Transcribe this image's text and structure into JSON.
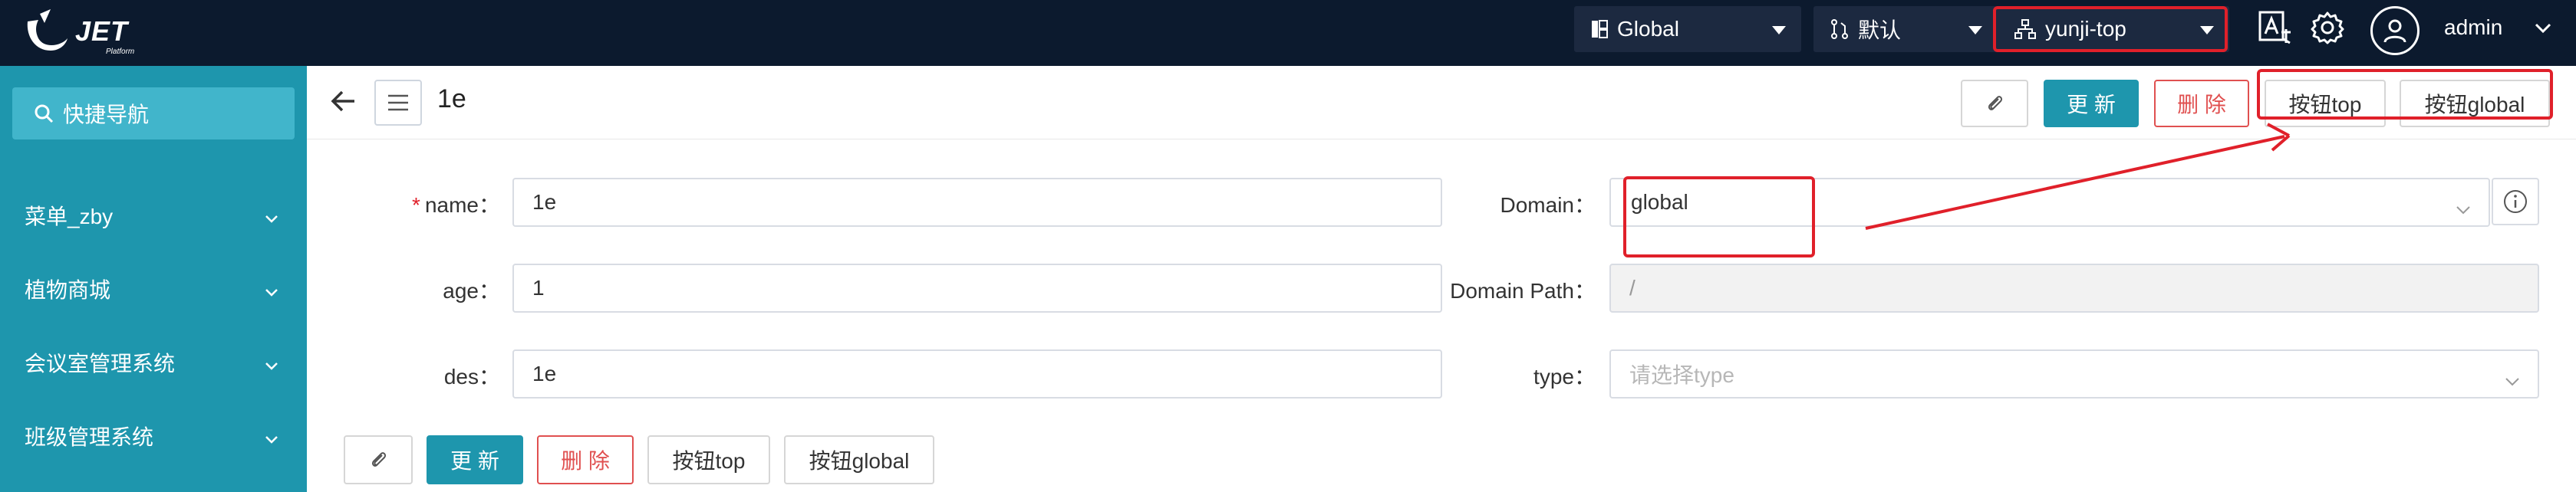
{
  "app": {
    "logo_text": "JET",
    "logo_sub": "Platform"
  },
  "topbar": {
    "scope_select": "Global",
    "branch_select": "默认",
    "org_select": "yunji-top",
    "user": "admin",
    "icons": [
      "translate-icon",
      "gear-icon",
      "user-avatar-icon",
      "chevron-down-icon"
    ]
  },
  "sidebar": {
    "search_label": "快捷导航",
    "items": [
      {
        "label": "菜单_zby"
      },
      {
        "label": "植物商城"
      },
      {
        "label": "会议室管理系统"
      },
      {
        "label": "班级管理系统"
      }
    ]
  },
  "header": {
    "title": "1e",
    "buttons": {
      "attach": "",
      "update": "更 新",
      "delete": "删 除",
      "btn_top": "按钮top",
      "btn_global": "按钮global"
    }
  },
  "form": {
    "name_label": "name",
    "name_value": "1e",
    "age_label": "age",
    "age_value": "1",
    "des_label": "des",
    "des_value": "1e",
    "domain_label": "Domain",
    "domain_value": "global",
    "domain_path_label": "Domain Path",
    "domain_path_value": "/",
    "type_label": "type",
    "type_placeholder": "请选择type",
    "colon": "："
  },
  "footer_buttons": {
    "update": "更 新",
    "delete": "删 除",
    "btn_top": "按钮top",
    "btn_global": "按钮global"
  },
  "colors": {
    "topbar_bg": "#0c1a2e",
    "sidebar_bg": "#1e96ad",
    "primary": "#1e96ad",
    "danger": "#e05050",
    "annotation_red": "#e0202a"
  }
}
